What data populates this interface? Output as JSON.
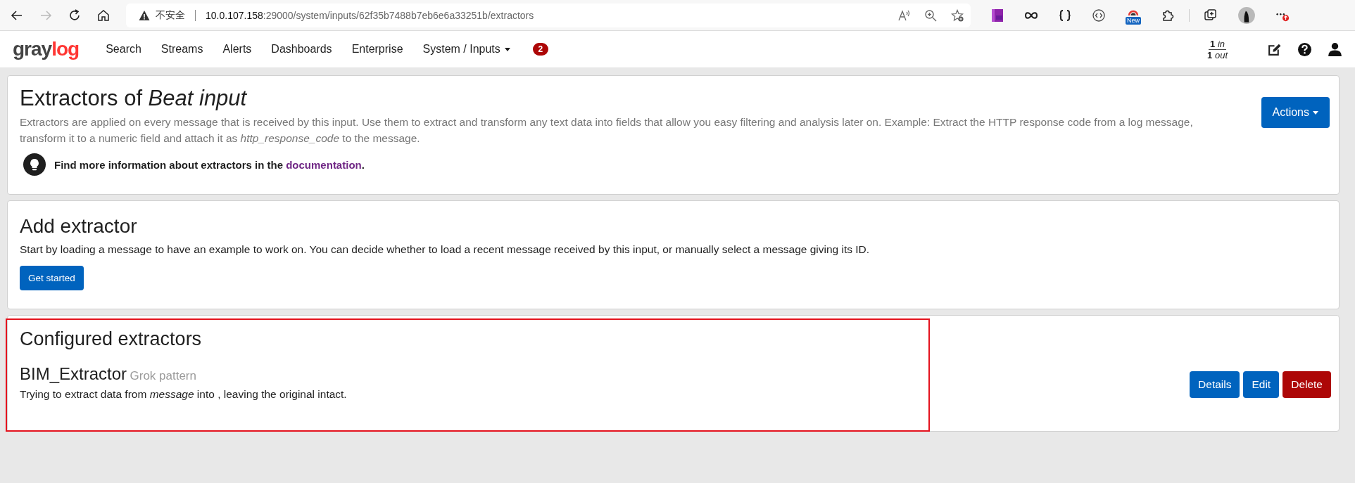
{
  "browser": {
    "nav_buttons": [
      {
        "kind": "back",
        "disabled": false
      },
      {
        "kind": "forward",
        "disabled": true
      },
      {
        "kind": "reload",
        "disabled": false
      },
      {
        "kind": "home",
        "disabled": false
      }
    ],
    "security_label": "不安全",
    "url_host": "10.0.107.158",
    "url_rest": ":29000/system/inputs/62f35b7488b7eb6e6a33251b/extractors",
    "extension_badge": "New"
  },
  "navbar": {
    "logo": {
      "parts": [
        "gray",
        "log"
      ]
    },
    "items": [
      {
        "label": "Search",
        "dropdown": false
      },
      {
        "label": "Streams",
        "dropdown": false
      },
      {
        "label": "Alerts",
        "dropdown": false
      },
      {
        "label": "Dashboards",
        "dropdown": false
      },
      {
        "label": "Enterprise",
        "dropdown": false
      },
      {
        "label": "System / Inputs",
        "dropdown": true
      }
    ],
    "notification_count": "2",
    "throughput": {
      "in": "**1** *in*",
      "out": "**1** *out*"
    }
  },
  "header": {
    "title": "Extractors of *Beat input*",
    "description": "Extractors are applied on every message that is received by this input. Use them to extract and transform any text data into fields that allow you easy filtering and analysis later on. Example: Extract the HTTP response code from a log message, transform it to a numeric field and attach it as *http_response_code* to the message.",
    "hint": "Find more information about extractors in the",
    "hint_link": "documentation",
    "hint_end": ".",
    "actions_button": "Actions"
  },
  "add_extractor": {
    "title": "Add extractor",
    "description": "Start by loading a message to have an example to work on. You can decide whether to load a recent message received by this input, or manually select a message giving its ID.",
    "button": "Get started"
  },
  "configured": {
    "title": "Configured extractors",
    "highlighted": true,
    "extractors": [
      {
        "name": "BIM_Extractor",
        "type": "Grok pattern",
        "description": "Trying to extract data from *message* into , leaving the original intact.",
        "buttons": [
          {
            "label": "Details",
            "kind": "primary"
          },
          {
            "label": "Edit",
            "kind": "primary"
          },
          {
            "label": "Delete",
            "kind": "danger"
          }
        ]
      }
    ]
  }
}
